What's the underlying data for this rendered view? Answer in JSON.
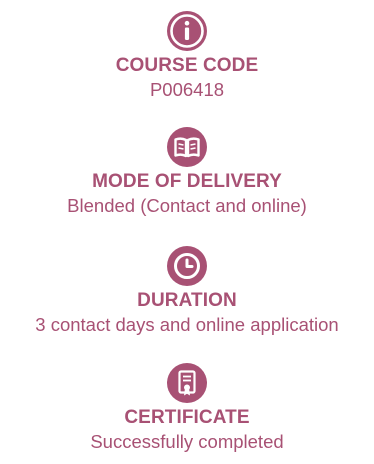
{
  "accent_color": "#a85174",
  "items": [
    {
      "icon": "info-icon",
      "title": "COURSE CODE",
      "value": "P006418"
    },
    {
      "icon": "book-icon",
      "title": "MODE OF DELIVERY",
      "value": "Blended (Contact and online)"
    },
    {
      "icon": "clock-icon",
      "title": "DURATION",
      "value": "3 contact days and online application"
    },
    {
      "icon": "certificate-icon",
      "title": "CERTIFICATE",
      "value": "Successfully completed"
    }
  ]
}
